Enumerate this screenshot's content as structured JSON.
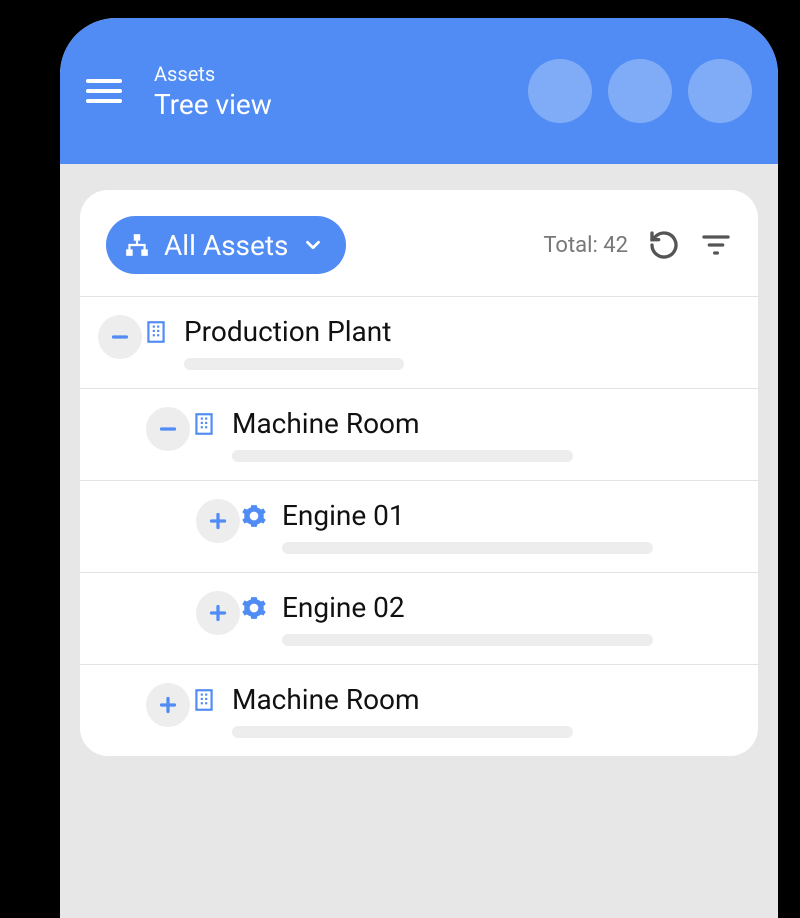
{
  "header": {
    "subtitle": "Assets",
    "title": "Tree view"
  },
  "toolbar": {
    "filter_label": "All Assets",
    "total_label": "Total: 42"
  },
  "tree": [
    {
      "label": "Production Plant",
      "level": 0,
      "type": "building",
      "expanded": true,
      "skeleton": "w40"
    },
    {
      "label": "Machine Room",
      "level": 1,
      "type": "building",
      "expanded": true,
      "skeleton": "w60"
    },
    {
      "label": "Engine 01",
      "level": 2,
      "type": "gear",
      "expanded": false,
      "skeleton": "w80"
    },
    {
      "label": "Engine 02",
      "level": 2,
      "type": "gear",
      "expanded": false,
      "skeleton": "w80"
    },
    {
      "label": "Machine Room",
      "level": 1,
      "type": "building",
      "expanded": false,
      "skeleton": "w60"
    }
  ],
  "colors": {
    "primary": "#508cf4"
  }
}
